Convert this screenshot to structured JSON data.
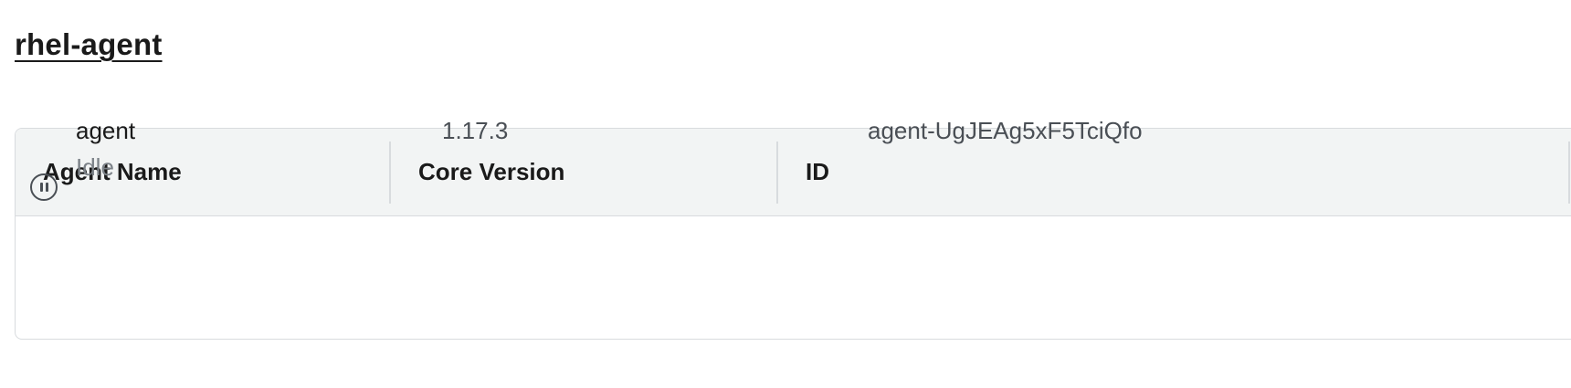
{
  "page": {
    "title": "rhel-agent"
  },
  "table": {
    "columns": [
      "Agent Name",
      "Core Version",
      "ID"
    ],
    "rows": [
      {
        "name": "agent",
        "status": "Idle",
        "status_icon": "pause-circle-icon",
        "core_version": "1.17.3",
        "id": "agent-UgJEAg5xF5TciQfo"
      }
    ]
  },
  "colors": {
    "header_bg": "#f2f4f4",
    "border": "#d8dbde",
    "muted_text": "#7c8288"
  }
}
